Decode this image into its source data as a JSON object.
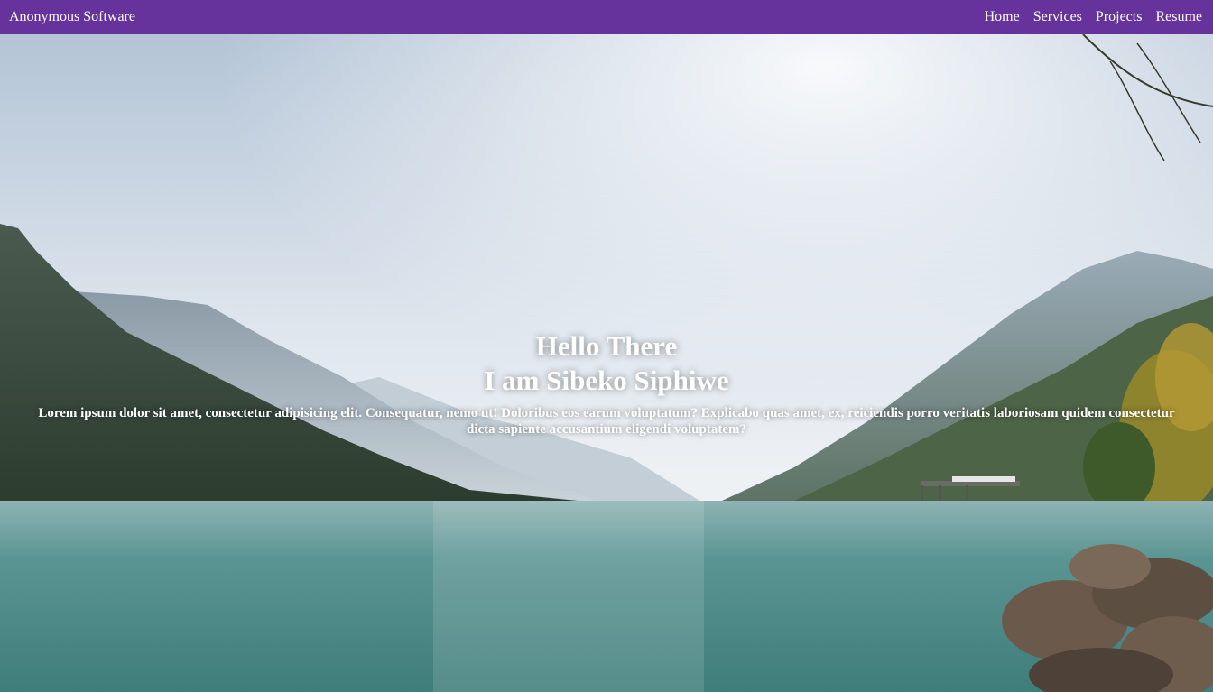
{
  "navbar": {
    "brand": "Anonymous Software",
    "links": [
      "Home",
      "Services",
      "Projects",
      "Resume"
    ],
    "background": "#66339c"
  },
  "hero": {
    "heading_line1": "Hello There",
    "heading_line2": "I am Sibeko Siphiwe",
    "paragraph": "Lorem ipsum dolor sit amet, consectetur adipisicing elit. Consequatur, nemo ut! Doloribus eos earum voluptatum? Explicabo quas amet, ex, reiciendis porro veritatis laboriosam quidem consectetur dicta sapiente accusantium eligendi voluptatem?",
    "background_description_icon": "lake-mountain-landscape-image"
  }
}
